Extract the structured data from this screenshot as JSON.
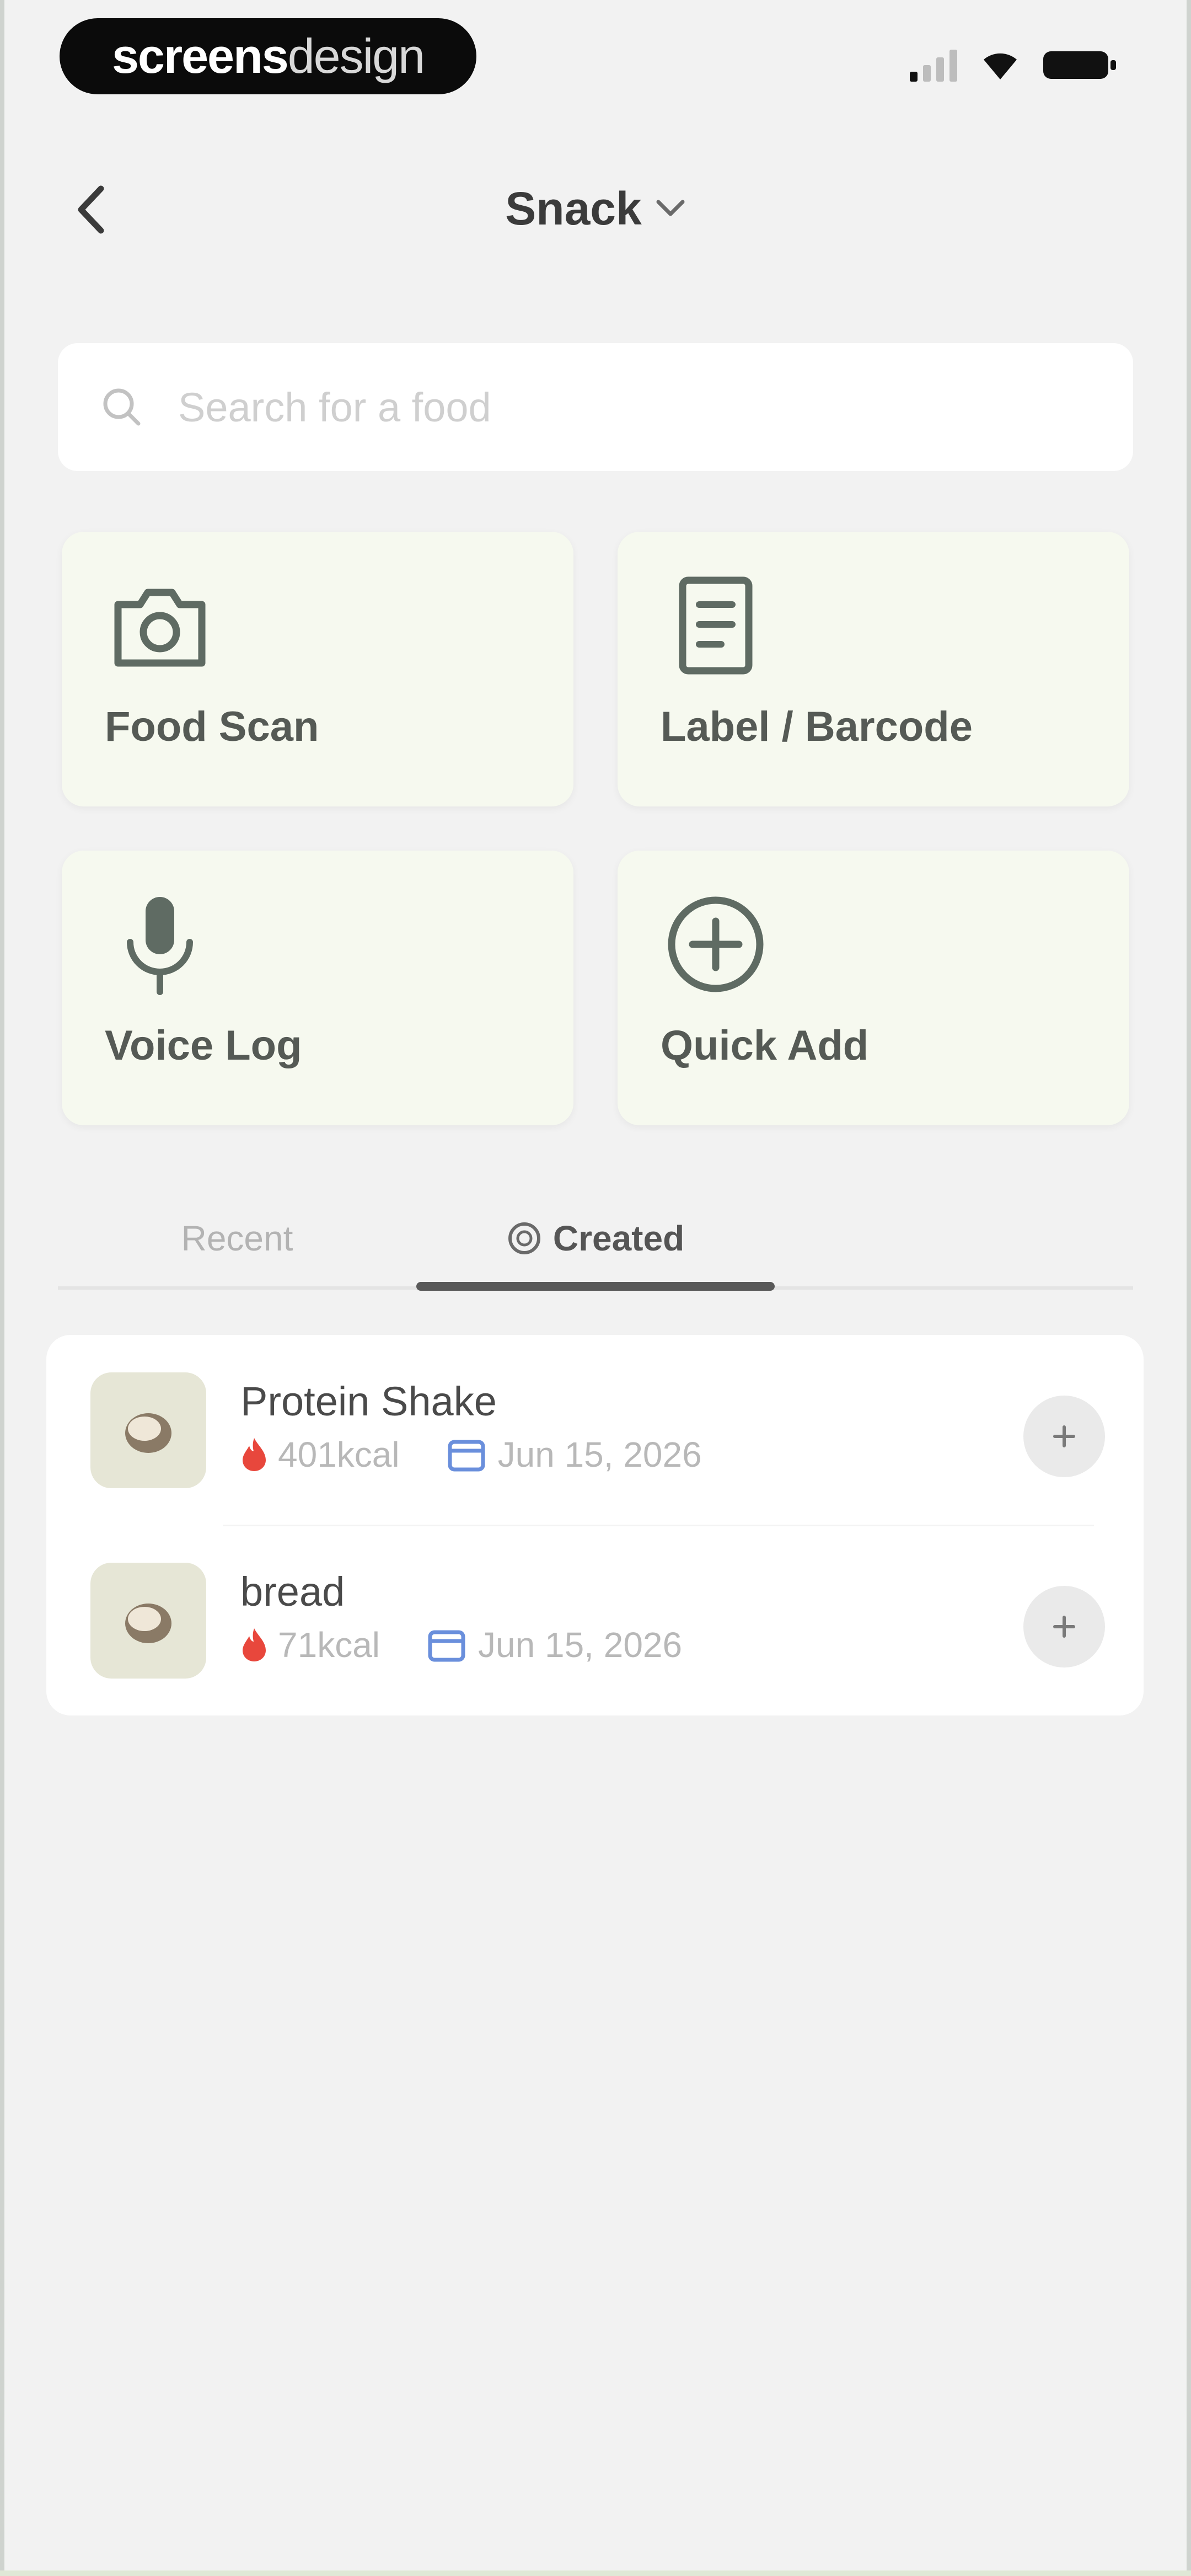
{
  "status_bar": {
    "brand_bold": "screens",
    "brand_light": "design"
  },
  "header": {
    "title": "Snack"
  },
  "search": {
    "placeholder": "Search for a food"
  },
  "actions": [
    {
      "label": "Food Scan",
      "icon": "camera-icon"
    },
    {
      "label": "Label / Barcode",
      "icon": "document-icon"
    },
    {
      "label": "Voice Log",
      "icon": "microphone-icon"
    },
    {
      "label": "Quick Add",
      "icon": "plus-circle-icon"
    }
  ],
  "tabs": [
    {
      "label": "Recent",
      "active": false
    },
    {
      "label": "Created",
      "active": true
    }
  ],
  "items": [
    {
      "name": "Protein Shake",
      "kcal": "401kcal",
      "date": "Jun 15, 2026"
    },
    {
      "name": "bread",
      "kcal": "71kcal",
      "date": "Jun 15, 2026"
    }
  ],
  "colors": {
    "background": "#f2f2f2",
    "card": "#f6f9ef",
    "icon": "#5f6b63",
    "flame": "#e8473c",
    "calendar": "#6a8fdc"
  }
}
